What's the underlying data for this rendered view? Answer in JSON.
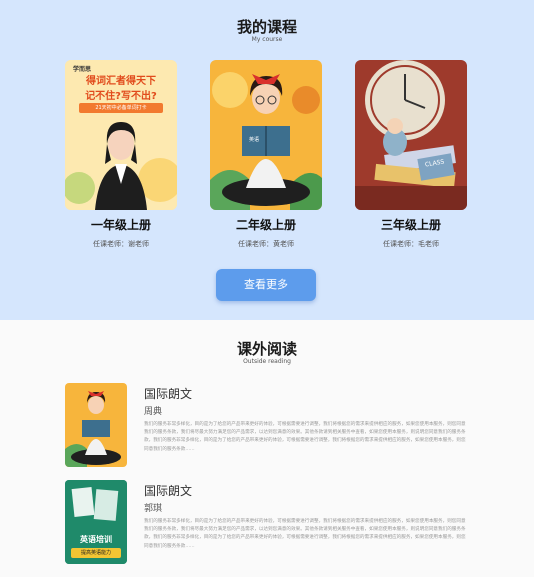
{
  "courses_section": {
    "title": "我的课程",
    "subtitle": "My course",
    "courses": [
      {
        "name": "一年级上册",
        "teacher": "任课老师：谢老师",
        "cover_texts": {
          "brand": "学而思",
          "line1": "得词汇者得天下",
          "line2": "记不住?写不出?",
          "banner": "21天初中必备单词打卡"
        }
      },
      {
        "name": "二年级上册",
        "teacher": "任课老师：黄老师",
        "cover_texts": {
          "book": "英语"
        }
      },
      {
        "name": "三年级上册",
        "teacher": "任课老师：毛老师",
        "cover_texts": {
          "book": "CLASS"
        }
      }
    ],
    "more_button": "查看更多"
  },
  "reading_section": {
    "title": "课外阅读",
    "subtitle": "Outside reading",
    "items": [
      {
        "title": "国际朗文",
        "author": "周典",
        "description": "我们的服务非常多样化，目的是为了给您的产品带来更好的体验，可根据需要进行调整，我们将根据您的需求来提供相应的服务，如果您使用本服务，则您同意我们的服务条款，我们将尽最大努力满足您的产品需求，以达到您满意的效果。其他条款请到相关服务中查看，如果您使用本服务，则说明您同意我们的服务条款，我们的服务非常多样化，目的是为了给您的产品带来更好的体验，可根据需要进行调整，我们将根据您的需求来提供相应的服务，如果您使用本服务，则您同意我们的服务条款……"
      },
      {
        "title": "国际朗文",
        "author": "郭琪",
        "description": "我们的服务非常多样化，目的是为了给您的产品带来更好的体验，可根据需要进行调整，我们将根据您的需求来提供相应的服务，如果您使用本服务，则您同意我们的服务条款，我们将尽最大努力满足您的产品需求，以达到您满意的效果。其他条款请到相关服务中查看，如果您使用本服务，则说明您同意我们的服务条款，我们的服务非常多样化，目的是为了给您的产品带来更好的体验，可根据需要进行调整，我们将根据您的需求来提供相应的服务，如果您使用本服务，则您同意我们的服务条款……",
        "cover_texts": {
          "line1": "英语培训",
          "line2": "提高英语能力"
        }
      }
    ]
  },
  "colors": {
    "top_bg": "#d5e6fd",
    "button": "#5d9cec",
    "bottom_bg": "#fafafa"
  }
}
